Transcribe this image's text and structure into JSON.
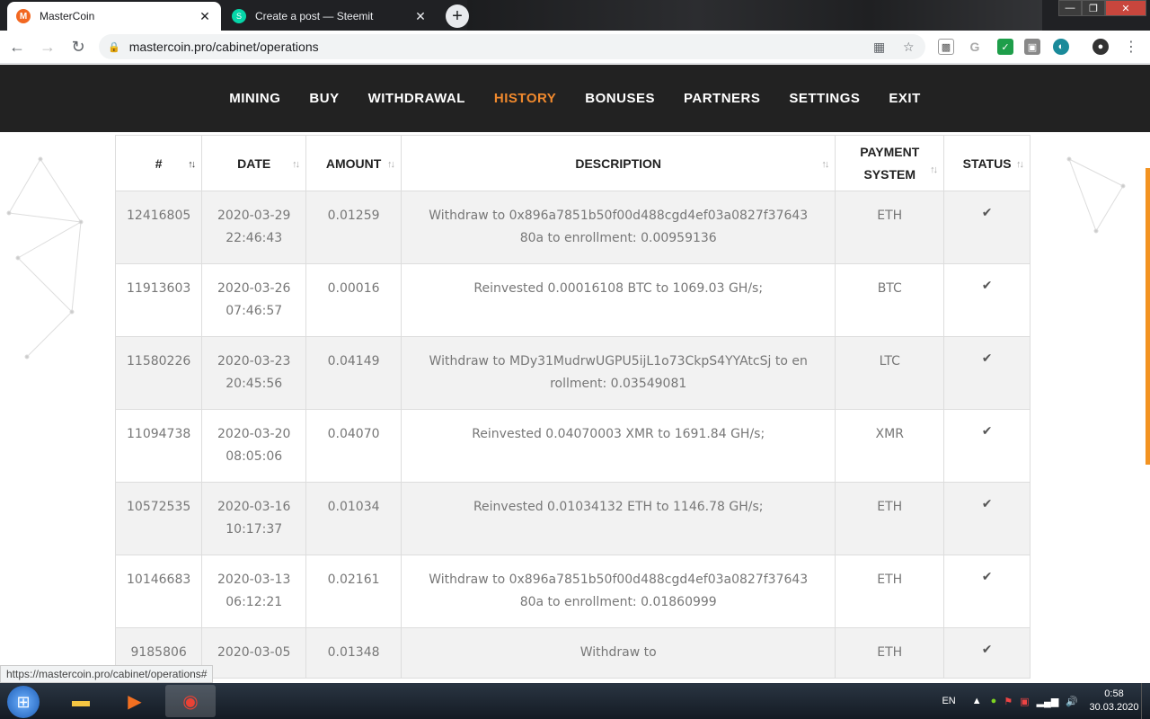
{
  "browser": {
    "tabs": [
      {
        "title": "MasterCoin",
        "favicon": "monero-icon",
        "active": true
      },
      {
        "title": "Create a post — Steemit",
        "favicon": "steemit-icon",
        "active": false
      }
    ],
    "url": "mastercoin.pro/cabinet/operations"
  },
  "nav": {
    "items": [
      {
        "label": "MINING"
      },
      {
        "label": "BUY"
      },
      {
        "label": "WITHDRAWAL"
      },
      {
        "label": "HISTORY",
        "active": true
      },
      {
        "label": "BONUSES"
      },
      {
        "label": "PARTNERS"
      },
      {
        "label": "SETTINGS"
      },
      {
        "label": "EXIT"
      }
    ],
    "active_color": "#f0892d"
  },
  "table": {
    "headers": {
      "num": "#",
      "date": "DATE",
      "amount": "AMOUNT",
      "description": "DESCRIPTION",
      "payment_1": "PAYMENT",
      "payment_2": "SYSTEM",
      "status": "STATUS"
    },
    "rows": [
      {
        "id": "12416805",
        "date": "2020-03-29",
        "time": "22:46:43",
        "amount": "0.01259",
        "description": "Withdraw to 0x896a7851b50f00d488cgd4ef03a0827f3764380a to enrollment: 0.00959136",
        "system": "ETH"
      },
      {
        "id": "11913603",
        "date": "2020-03-26",
        "time": "07:46:57",
        "amount": "0.00016",
        "description": "Reinvested 0.00016108 BTC to 1069.03 GH/s;",
        "system": "BTC"
      },
      {
        "id": "11580226",
        "date": "2020-03-23",
        "time": "20:45:56",
        "amount": "0.04149",
        "description": "Withdraw to MDy31MudrwUGPU5ijL1o73CkpS4YYAtcSj to enrollment: 0.03549081",
        "system": "LTC"
      },
      {
        "id": "11094738",
        "date": "2020-03-20",
        "time": "08:05:06",
        "amount": "0.04070",
        "description": "Reinvested 0.04070003 XMR to 1691.84 GH/s;",
        "system": "XMR"
      },
      {
        "id": "10572535",
        "date": "2020-03-16",
        "time": "10:17:37",
        "amount": "0.01034",
        "description": "Reinvested 0.01034132 ETH to 1146.78 GH/s;",
        "system": "ETH"
      },
      {
        "id": "10146683",
        "date": "2020-03-13",
        "time": "06:12:21",
        "amount": "0.02161",
        "description": "Withdraw to 0x896a7851b50f00d488cgd4ef03a0827f3764380a to enrollment: 0.01860999",
        "system": "ETH"
      },
      {
        "id": "9185806",
        "date": "2020-03-05",
        "time": "",
        "amount": "0.01348",
        "description": "Withdraw to",
        "system": "ETH"
      }
    ]
  },
  "statusbar_url": "https://mastercoin.pro/cabinet/operations#",
  "taskbar": {
    "lang": "EN",
    "time": "0:58",
    "date": "30.03.2020"
  }
}
